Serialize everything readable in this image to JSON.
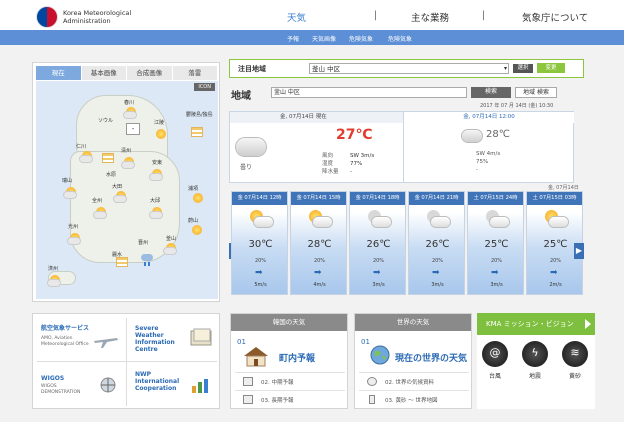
{
  "header": {
    "logo_line1": "Korea Meteorological",
    "logo_line2": "Administration",
    "nav": [
      "天気",
      "主な業務",
      "気象庁について"
    ],
    "separator": "|",
    "subnav": [
      "予報",
      "天気画像",
      "危険気象",
      "危険気象"
    ]
  },
  "map_panel": {
    "tabs": [
      "現在",
      "基本画像",
      "合成画像",
      "落雷"
    ],
    "icon_button": "ICON",
    "cities": [
      "春川",
      "ソウル",
      "江陵",
      "鬱陵島/独島",
      "仁川",
      "清州",
      "安東",
      "水原",
      "瑞山",
      "大田",
      "浦項",
      "全州",
      "大邱",
      "蔚山",
      "光州",
      "釜山",
      "晋州",
      "麗水",
      "済州"
    ],
    "dash_text": "-"
  },
  "search": {
    "label": "注目地域",
    "selected": "釜山 中区",
    "select_btn": "選択",
    "change_btn": "変更"
  },
  "region": {
    "title": "地域",
    "value": "釜山 中区",
    "search_btn": "検索",
    "region_search_btn": "地域 検索",
    "timestamp": "2017 年 07 月 14日 (金) 10:30"
  },
  "current": {
    "left_header": "金, 07月14日  現在",
    "right_header": "金, 07月14日  12:00",
    "condition": "曇り",
    "temp_now": "27℃",
    "temp_noon": "28℃",
    "labels": [
      "風向",
      "湿度",
      "降水量"
    ],
    "values": [
      "SW 3m/s",
      "77%",
      "-"
    ],
    "noon_wind": "SW 4m/s",
    "noon_humidity": "75%",
    "noon_precip": "-"
  },
  "forecast": {
    "date_note": "金, 07月14日",
    "prev": "◀",
    "next": "▶",
    "wind_arrow": "➡",
    "cards": [
      {
        "head": "金 07月14日 12時",
        "temp": "30℃",
        "pct": "20%",
        "speed": "5m/s"
      },
      {
        "head": "金 07月14日 15時",
        "temp": "28℃",
        "pct": "20%",
        "speed": "4m/s"
      },
      {
        "head": "金 07月14日 18時",
        "temp": "26℃",
        "pct": "20%",
        "speed": "3m/s"
      },
      {
        "head": "金 07月14日 21時",
        "temp": "26℃",
        "pct": "20%",
        "speed": "3m/s"
      },
      {
        "head": "土 07月15日 24時",
        "temp": "25℃",
        "pct": "20%",
        "speed": "3m/s"
      },
      {
        "head": "土 07月15日 03時",
        "temp": "25℃",
        "pct": "20%",
        "speed": "2m/s"
      }
    ]
  },
  "orgs": [
    {
      "title": "航空気象サービス",
      "sub": "AMO, Aviation Meteorological Office"
    },
    {
      "title": "Severe Weather Information Centre",
      "sub": ""
    },
    {
      "title": "WIGOS",
      "sub": "WIGOS DEMONSTRATION"
    },
    {
      "title": "NWP International Cooperation",
      "sub": ""
    }
  ],
  "korea_weather": {
    "head": "韓国の天気",
    "num1": "01",
    "main": "町内予報",
    "item2": "02. 中期予報",
    "item3": "03. 長期予報"
  },
  "world_weather": {
    "head": "世界の天気",
    "num1": "01",
    "main": "現在の世界の天気",
    "item2": "02. 世界の気候資料",
    "item3": "03. 黄砂 ～ 世界地図"
  },
  "kma": {
    "head": "KMA ミッション・ビジョン",
    "hazards": [
      "台風",
      "地震",
      "黄砂"
    ],
    "glyphs": [
      "@",
      "ϟ",
      "≋"
    ]
  },
  "colors": {
    "accent_blue": "#3b7fd1",
    "subnav_blue": "#5c8fd6",
    "green": "#8cc63f",
    "temp_red": "#e23b2e"
  }
}
